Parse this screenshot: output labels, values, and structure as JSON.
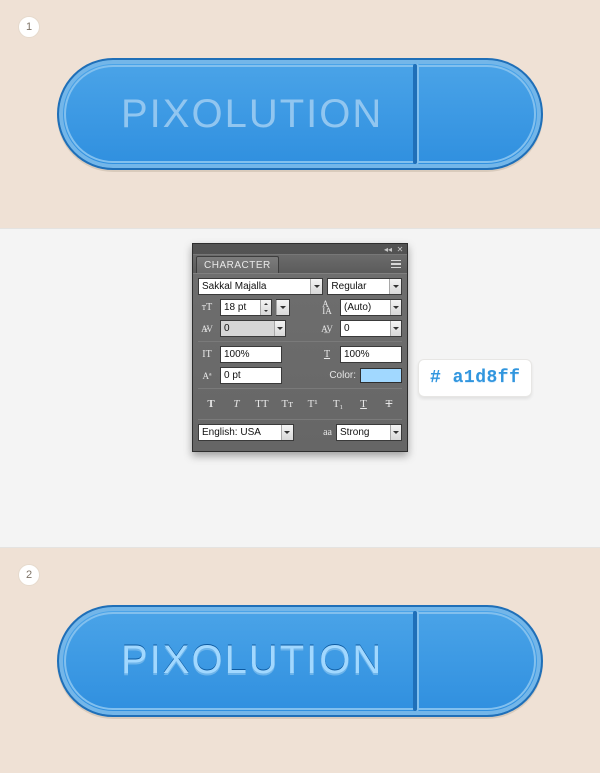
{
  "step1_num": "1",
  "step2_num": "2",
  "button_label_1": "PIXOLUTION",
  "button_label_2": "PIXOLUTION",
  "swatch_text": "# a1d8ff",
  "panel": {
    "tab": "CHARACTER",
    "font_family": "Sakkal Majalla",
    "font_style": "Regular",
    "font_size": "18 pt",
    "leading": "(Auto)",
    "kerning": "0",
    "tracking": "0",
    "vscale": "100%",
    "hscale": "100%",
    "baseline": "0 pt",
    "color_label": "Color:",
    "color_hex": "#a1d8ff",
    "language": "English: USA",
    "aa_label": "aa",
    "aa_mode": "Strong",
    "ot": {
      "bold": "T",
      "italic": "T",
      "allcaps": "TT",
      "smallcaps": "Tт",
      "superscript": "T¹",
      "subscript": "T₁",
      "underline": "T",
      "strike": "T"
    }
  }
}
